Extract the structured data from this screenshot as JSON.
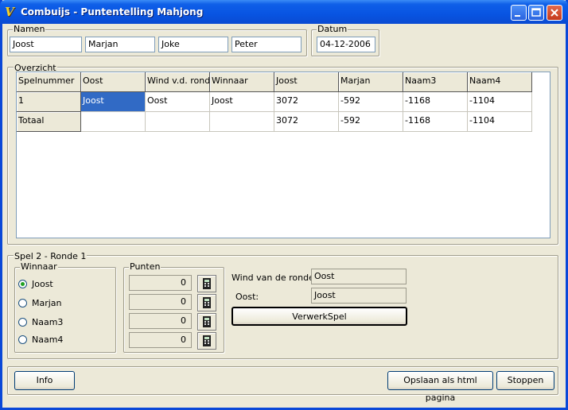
{
  "window": {
    "title": "Combuijs - Puntentelling Mahjong"
  },
  "namen": {
    "legend": "Namen",
    "players": [
      "Joost",
      "Marjan",
      "Joke",
      "Peter"
    ]
  },
  "datum": {
    "legend": "Datum",
    "value": "04-12-2006"
  },
  "overzicht": {
    "legend": "Overzicht",
    "headers": [
      "Spelnummer",
      "Oost",
      "Wind v.d. ronde",
      "Winnaar",
      "Joost",
      "Marjan",
      "Naam3",
      "Naam4"
    ],
    "rows": [
      [
        "1",
        "Joost",
        "Oost",
        "Joost",
        "3072",
        "-592",
        "-1168",
        "-1104"
      ],
      [
        "Totaal",
        "",
        "",
        "",
        "3072",
        "-592",
        "-1168",
        "-1104"
      ]
    ]
  },
  "spel": {
    "legend": "Spel 2 - Ronde 1",
    "winnaar": {
      "legend": "Winnaar",
      "options": [
        "Joost",
        "Marjan",
        "Naam3",
        "Naam4"
      ],
      "selected": "Joost"
    },
    "punten": {
      "legend": "Punten",
      "values": [
        "0",
        "0",
        "0",
        "0"
      ]
    },
    "wind_label": "Wind van de ronde:",
    "wind_value": "Oost",
    "oost_label": "Oost:",
    "oost_value": "Joost",
    "verwerk_label": "VerwerkSpel"
  },
  "footer": {
    "info_label": "Info",
    "save_label": "Opslaan als html pagina",
    "stop_label": "Stoppen"
  },
  "colors": {
    "titlebar": "#0854e2",
    "selection": "#316ac5",
    "face": "#ece9d8"
  }
}
